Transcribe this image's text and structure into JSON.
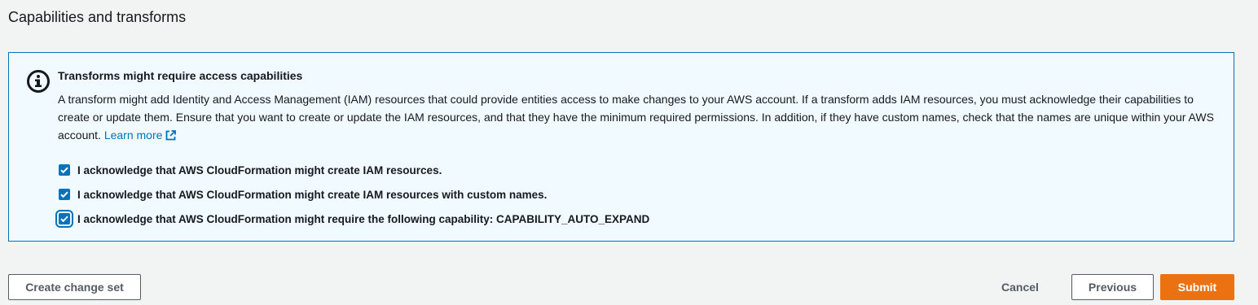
{
  "section": {
    "title": "Capabilities and transforms"
  },
  "alert": {
    "title": "Transforms might require access capabilities",
    "body": "A transform might add Identity and Access Management (IAM) resources that could provide entities access to make changes to your AWS account. If a transform adds IAM resources, you must acknowledge their capabilities to create or update them. Ensure that you want to create or update the IAM resources, and that they have the minimum required permissions. In addition, if they have custom names, check that the names are unique within your AWS account.",
    "learn_more": "Learn more",
    "icon": "info-icon"
  },
  "acknowledgements": [
    {
      "label": "I acknowledge that AWS CloudFormation might create IAM resources.",
      "checked": true
    },
    {
      "label": "I acknowledge that AWS CloudFormation might create IAM resources with custom names.",
      "checked": true
    },
    {
      "label": "I acknowledge that AWS CloudFormation might require the following capability: CAPABILITY_AUTO_EXPAND",
      "checked": true
    }
  ],
  "actions": {
    "create_change_set": "Create change set",
    "cancel": "Cancel",
    "previous": "Previous",
    "submit": "Submit"
  },
  "colors": {
    "accent": "#0073bb",
    "primary_button": "#ec7211",
    "alert_background": "#f1faff",
    "page_background": "#f2f3f3"
  }
}
